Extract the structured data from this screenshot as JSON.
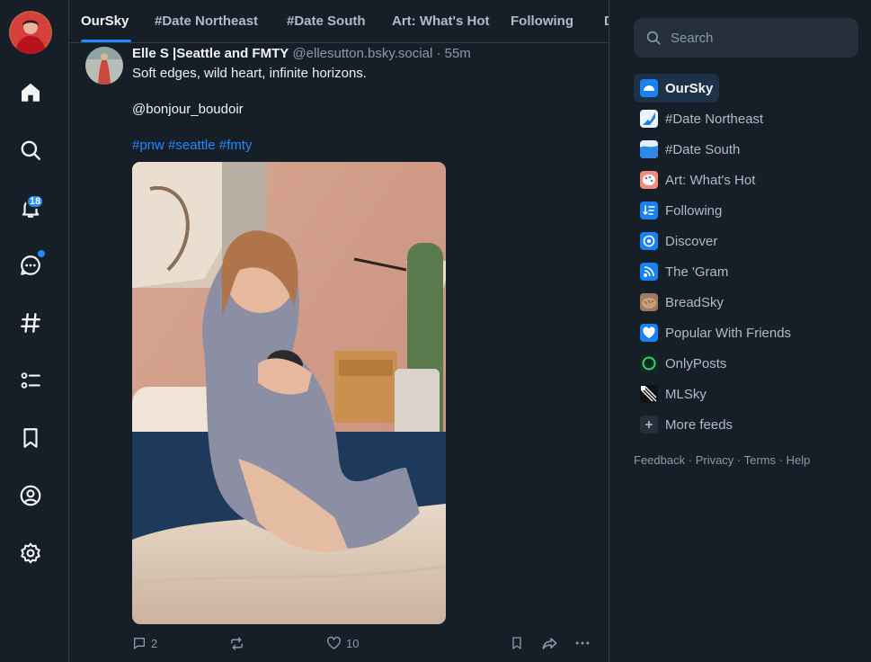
{
  "nav": {
    "notifications_badge": "18"
  },
  "feed_tabs": [
    {
      "label": "OurSky"
    },
    {
      "label": "#Date Northeast"
    },
    {
      "label": "#Date South"
    },
    {
      "label": "Art: What's Hot"
    },
    {
      "label": "Following"
    },
    {
      "label": "D"
    }
  ],
  "post": {
    "author_name": "Elle S |Seattle and FMTY",
    "handle": "@ellesutton.bsky.social",
    "separator": "·",
    "time": "55m",
    "line1": "Soft edges, wild heart, infinite horizons.",
    "line2": "@bonjour_boudoir",
    "hashtags": [
      "#pnw",
      "#seattle",
      "#fmty"
    ],
    "reply_count": "2",
    "like_count": "10"
  },
  "right": {
    "search_placeholder": "Search",
    "feeds": [
      {
        "label": "OurSky",
        "icon": "oursky-icon",
        "active": true
      },
      {
        "label": "#Date Northeast",
        "icon": "date-northeast-icon"
      },
      {
        "label": "#Date South",
        "icon": "date-south-icon"
      },
      {
        "label": "Art: What's Hot",
        "icon": "art-palette-icon"
      },
      {
        "label": "Following",
        "icon": "following-icon"
      },
      {
        "label": "Discover",
        "icon": "discover-icon"
      },
      {
        "label": "The 'Gram",
        "icon": "gram-icon"
      },
      {
        "label": "BreadSky",
        "icon": "bread-icon"
      },
      {
        "label": "Popular With Friends",
        "icon": "heart-icon"
      },
      {
        "label": "OnlyPosts",
        "icon": "circle-icon"
      },
      {
        "label": "MLSky",
        "icon": "mlsky-icon"
      },
      {
        "label": "More feeds",
        "icon": "plus-icon"
      }
    ],
    "footer": [
      "Feedback",
      "Privacy",
      "Terms",
      "Help"
    ],
    "footer_separator": "·"
  },
  "colors": {
    "background": "#161e27",
    "accent": "#208bfe",
    "muted": "#8a9aab"
  }
}
